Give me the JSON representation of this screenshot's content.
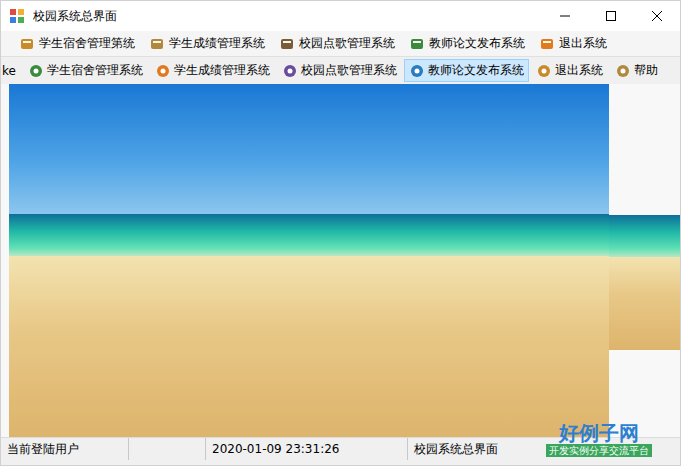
{
  "window": {
    "title": "校园系统总界面"
  },
  "menu": [
    {
      "label": "学生宿舍管理第统"
    },
    {
      "label": "学生成绩管理系统"
    },
    {
      "label": "校园点歌管理系统"
    },
    {
      "label": "教师论文发布系统"
    },
    {
      "label": "退出系统"
    }
  ],
  "toolbar": [
    {
      "label": "ke",
      "selected": false
    },
    {
      "label": "学生宿舍管理系统",
      "selected": false
    },
    {
      "label": "学生成绩管理系统",
      "selected": false
    },
    {
      "label": "校园点歌管理系统",
      "selected": false
    },
    {
      "label": "教师论文发布系统",
      "selected": true
    },
    {
      "label": "退出系统",
      "selected": false
    },
    {
      "label": "帮助",
      "selected": false
    }
  ],
  "status_bar": {
    "user": "当前登陆用户",
    "time": "2020-01-09 23:31:26",
    "form": "校园系统总界面"
  },
  "watermark": {
    "logo": "好例子网",
    "slogan": "开发实例分享交流平台"
  }
}
